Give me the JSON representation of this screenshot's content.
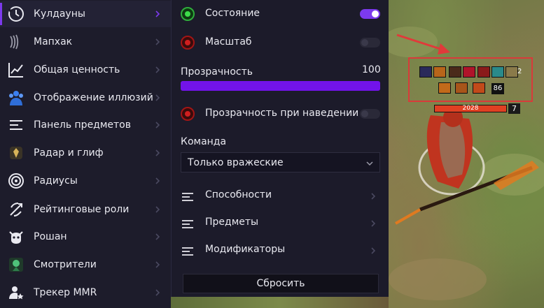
{
  "menu": {
    "items": [
      {
        "label": "Кулдауны",
        "icon": "clock-history-icon",
        "active": true
      },
      {
        "label": "Мапхак",
        "icon": "sound-waves-icon"
      },
      {
        "label": "Общая ценность",
        "icon": "line-chart-icon"
      },
      {
        "label": "Отображение иллюзий",
        "icon": "illusion-hero-icon"
      },
      {
        "label": "Панель предметов",
        "icon": "text-lines-icon"
      },
      {
        "label": "Радар и глиф",
        "icon": "radar-glyph-icon"
      },
      {
        "label": "Радиусы",
        "icon": "radius-target-icon"
      },
      {
        "label": "Рейтинговые роли",
        "icon": "bow-arrow-icon"
      },
      {
        "label": "Рошан",
        "icon": "roshan-icon"
      },
      {
        "label": "Смотрители",
        "icon": "ward-icon"
      },
      {
        "label": "Трекер MMR",
        "icon": "mmr-user-star-icon"
      }
    ]
  },
  "panel": {
    "state": {
      "label": "Состояние",
      "enabled": true
    },
    "scale": {
      "label": "Масштаб",
      "enabled": false
    },
    "opacity": {
      "label": "Прозрачность",
      "value": "100",
      "fraction": 1.0
    },
    "hover_opacity": {
      "label": "Прозрачность при наведении",
      "enabled": false
    },
    "team": {
      "label": "Команда",
      "selected": "Только вражеские"
    },
    "subsections": [
      {
        "label": "Способности"
      },
      {
        "label": "Предметы"
      },
      {
        "label": "Модификаторы"
      }
    ],
    "reset_label": "Сбросить"
  },
  "game": {
    "hero_hp": "2028",
    "hero_level": "7",
    "item_charges": "86",
    "stack_count": "2",
    "colors": {
      "highlight": "#d93a3a",
      "accent": "#7c3aed",
      "hp": "#e04022"
    }
  }
}
